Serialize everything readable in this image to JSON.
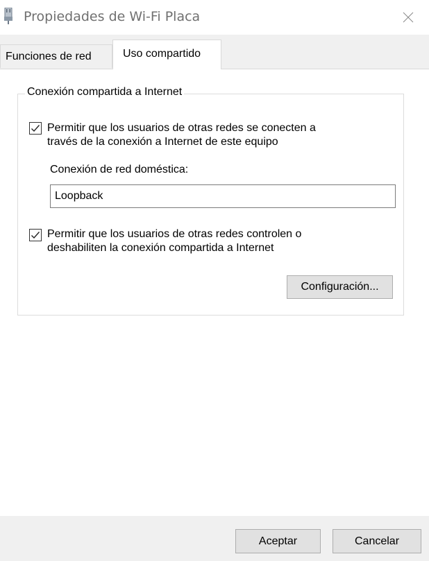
{
  "window": {
    "title": "Propiedades de Wi-Fi Placa",
    "icon": "network-adapter-icon",
    "close_icon": "close-icon"
  },
  "tabs": [
    {
      "label": "Funciones de red",
      "active": false
    },
    {
      "label": "Uso compartido",
      "active": true
    }
  ],
  "sharing": {
    "group_title": "Conexión compartida a Internet",
    "allow_connect": {
      "checked": true,
      "line1": "Permitir que los usuarios de otras redes se conecten a",
      "line2": "través de la conexión a Internet de este equipo"
    },
    "home_network_label": "Conexión de red doméstica:",
    "home_network_value": "Loopback",
    "allow_control": {
      "checked": true,
      "line1": "Permitir que los usuarios de otras redes controlen o",
      "line2": "deshabiliten la conexión compartida a Internet"
    },
    "settings_button": "Configuración..."
  },
  "footer": {
    "ok_label": "Aceptar",
    "cancel_label": "Cancelar"
  }
}
